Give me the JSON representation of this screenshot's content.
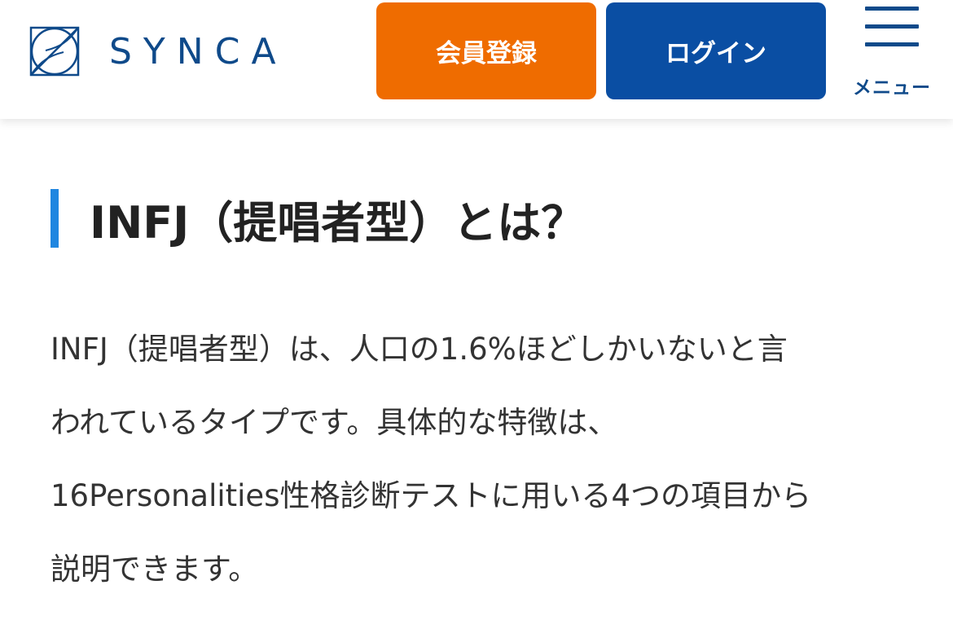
{
  "header": {
    "logo_text": "SYNCA",
    "register_label": "会員登録",
    "login_label": "ログイン",
    "menu_label": "メニュー"
  },
  "article": {
    "heading": "INFJ（提唱者型）とは？",
    "paragraph_lines": [
      "INFJ（提唱者型）は、人口の1.6%ほどしかいないと言",
      "われているタイプです。具体的な特徴は、",
      "16Personalities性格診断テストに用いる4つの項目から",
      "説明できます。"
    ]
  },
  "colors": {
    "brand_navy": "#0f4a8a",
    "register_orange": "#ef6c00",
    "login_blue": "#0a4ea3",
    "heading_accent": "#1f86e0",
    "text": "#222222"
  },
  "icons": {
    "logo": "synca-logo-mark",
    "menu": "hamburger-menu-icon"
  }
}
